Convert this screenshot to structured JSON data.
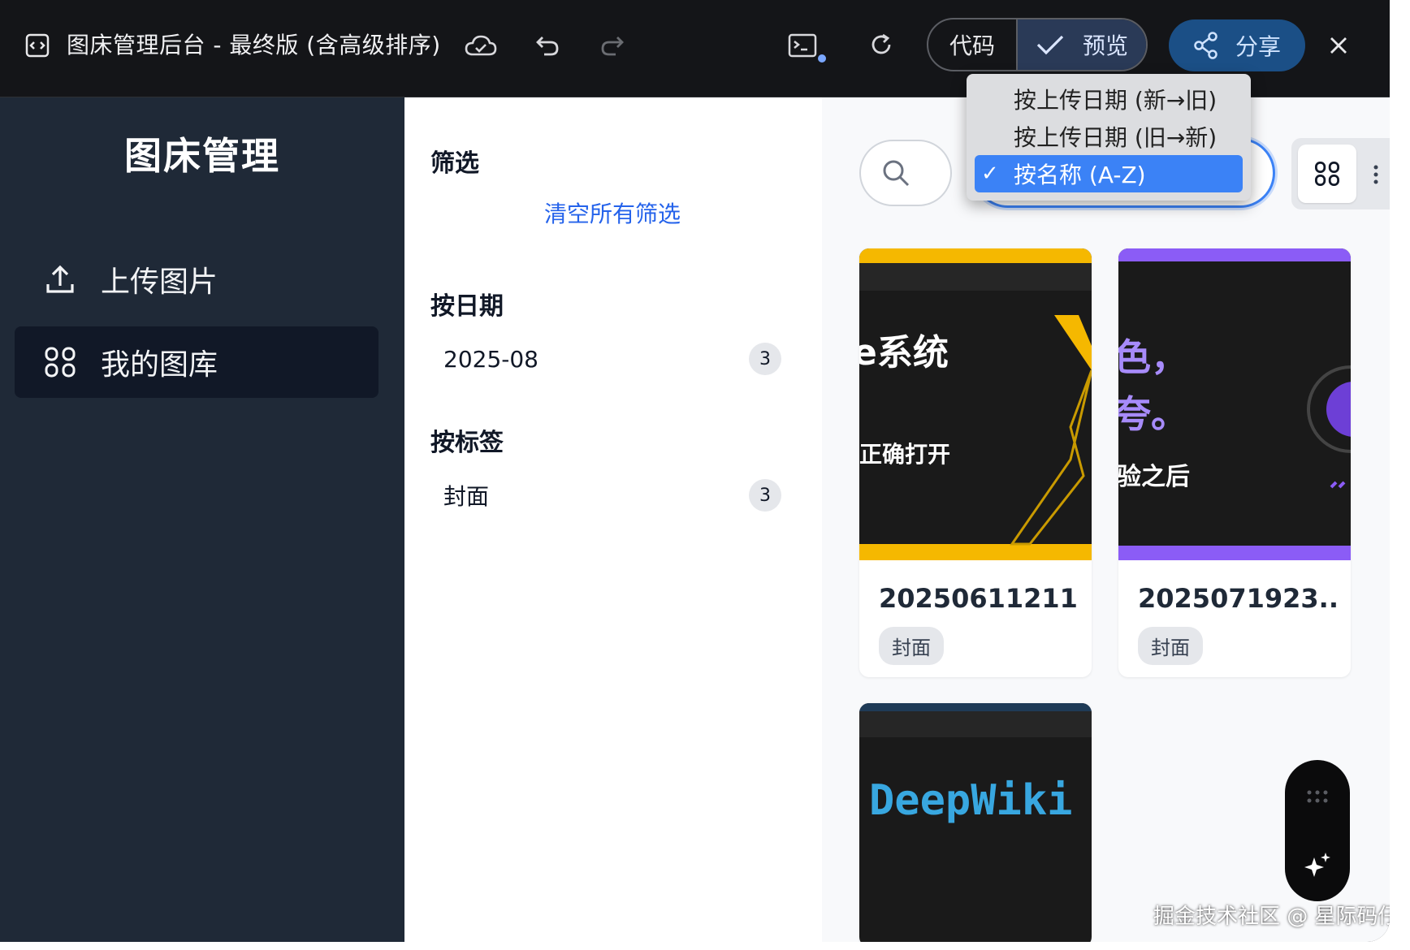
{
  "window": {
    "title": "图床管理后台 - 最终版 (含高级排序)",
    "code_label": "代码",
    "preview_label": "预览",
    "share_label": "分享"
  },
  "sidebar": {
    "brand": "图床管理",
    "items": [
      {
        "label": "上传图片",
        "icon": "upload-icon"
      },
      {
        "label": "我的图库",
        "icon": "grid-icon",
        "active": true
      }
    ]
  },
  "filters": {
    "title": "筛选",
    "clear_all": "清空所有筛选",
    "by_date": {
      "heading": "按日期",
      "items": [
        {
          "label": "2025-08",
          "count": "3"
        }
      ]
    },
    "by_tag": {
      "heading": "按标签",
      "items": [
        {
          "label": "封面",
          "count": "3"
        }
      ]
    }
  },
  "sort": {
    "options": [
      {
        "label": "按上传日期 (新→旧)"
      },
      {
        "label": "按上传日期 (旧→新)"
      },
      {
        "label": "按名称 (A-Z)",
        "selected": true,
        "check": "✓"
      }
    ]
  },
  "gallery": {
    "cards": [
      {
        "title": "20250611211...",
        "tag": "封面",
        "thumb_texts": [
          "e系统",
          "正确打开"
        ],
        "accent": "#f5b800"
      },
      {
        "title": "2025071923...",
        "tag": "封面",
        "thumb_texts": [
          "色，",
          "夸。",
          "验之后"
        ],
        "accent": "#8b5cf6"
      },
      {
        "title": "",
        "tag": "",
        "thumb_texts": [
          "DeepWiki"
        ],
        "accent": "#1f3b57"
      }
    ]
  },
  "watermark": "掘金技术社区 @ 星际码仔",
  "colors": {
    "sidebar_bg": "#1f2937",
    "accent_blue": "#3b82f6",
    "link_blue": "#2563eb",
    "share_bg": "#1b4f86"
  }
}
